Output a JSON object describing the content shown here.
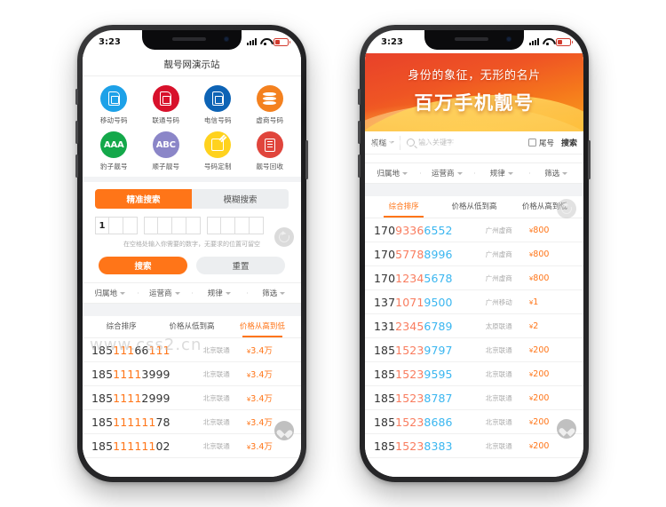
{
  "status_bar": {
    "time": "3:23",
    "signal_icon": "signal-bars-icon",
    "wifi_icon": "wifi-icon",
    "battery_icon": "battery-low-icon"
  },
  "watermark": {
    "text": "www.css2.cn"
  },
  "left_phone": {
    "app_title": "靓号网演示站",
    "categories": [
      {
        "label": "移动号码",
        "glyph": "sim-card-icon",
        "color": "#1da1e8"
      },
      {
        "label": "联通号码",
        "glyph": "sim-card-icon",
        "color": "#d8112b"
      },
      {
        "label": "电信号码",
        "glyph": "sim-card-icon",
        "color": "#0d63b5"
      },
      {
        "label": "虚商号码",
        "glyph": "coin-stack-icon",
        "color": "#f4811f"
      },
      {
        "label": "豹子靓号",
        "glyph": "aaa-text-icon",
        "color": "#14a84a",
        "text": "AAA"
      },
      {
        "label": "顺子靓号",
        "glyph": "abc-text-icon",
        "color": "#8b86c8",
        "text": "ABC"
      },
      {
        "label": "号码定制",
        "glyph": "pencil-edit-icon",
        "color": "#ffd21e"
      },
      {
        "label": "靓号回收",
        "glyph": "document-icon",
        "color": "#e0453c"
      }
    ],
    "search_tabs": [
      {
        "label": "精准搜索",
        "active": true
      },
      {
        "label": "模糊搜索",
        "active": false
      }
    ],
    "digit_groups": [
      [
        "1",
        "",
        ""
      ],
      [
        "",
        "",
        "",
        ""
      ],
      [
        "",
        "",
        "",
        ""
      ]
    ],
    "hint": "在空格处输入你需要的数字，无要求的位置可留空",
    "buttons": {
      "search": "搜索",
      "reset": "重置"
    },
    "filters": [
      "归属地",
      "运营商",
      "规律",
      "筛选"
    ],
    "sort_tabs": [
      {
        "label": "综合排序",
        "active": false
      },
      {
        "label": "价格从低到高",
        "active": false
      },
      {
        "label": "价格从高到低",
        "active": true
      }
    ],
    "numbers": [
      {
        "prefix": "185",
        "mid": "111",
        "suffix": "66",
        "tail": "111",
        "carrier": "北京联通",
        "currency": "¥",
        "price": "3.4万"
      },
      {
        "prefix": "185",
        "mid": "1111",
        "suffix": "3999",
        "tail": "",
        "carrier": "北京联通",
        "currency": "¥",
        "price": "3.4万"
      },
      {
        "prefix": "185",
        "mid": "1111",
        "suffix": "2999",
        "tail": "",
        "carrier": "北京联通",
        "currency": "¥",
        "price": "3.4万"
      },
      {
        "prefix": "185",
        "mid": "111111",
        "suffix": "78",
        "tail": "",
        "carrier": "北京联通",
        "currency": "¥",
        "price": "3.4万"
      },
      {
        "prefix": "185",
        "mid": "111111",
        "suffix": "02",
        "tail": "",
        "carrier": "北京联通",
        "currency": "¥",
        "price": "3.4万"
      }
    ],
    "fab": {
      "reset": "refresh-icon",
      "favorite": "heart-icon"
    }
  },
  "right_phone": {
    "banner": {
      "line1": "身份的象征，无形的名片",
      "line2": "百万手机靓号"
    },
    "search": {
      "mode_label": "模糊",
      "placeholder": "输入关键字",
      "checkbox_label": "尾号",
      "button_label": "搜索",
      "search_icon": "magnifier-icon"
    },
    "filters": [
      "归属地",
      "运营商",
      "规律",
      "筛选"
    ],
    "sort_tabs": [
      {
        "label": "综合排序",
        "active": true
      },
      {
        "label": "价格从低到高",
        "active": false
      },
      {
        "label": "价格从高到低",
        "active": false
      }
    ],
    "numbers": [
      {
        "prefix": "170",
        "orange": "9336",
        "blue": "6552",
        "carrier": "广州虚商",
        "currency": "¥",
        "price": "800"
      },
      {
        "prefix": "170",
        "orange": "5778",
        "blue": "8996",
        "carrier": "广州虚商",
        "currency": "¥",
        "price": "800"
      },
      {
        "prefix": "170",
        "orange": "1234",
        "blue": "5678",
        "carrier": "广州虚商",
        "currency": "¥",
        "price": "800"
      },
      {
        "prefix": "137",
        "orange": "1071",
        "blue": "9500",
        "carrier": "广州移动",
        "currency": "¥",
        "price": "1"
      },
      {
        "prefix": "131",
        "orange": "2345",
        "blue": "6789",
        "carrier": "太原联通",
        "currency": "¥",
        "price": "2"
      },
      {
        "prefix": "185",
        "orange": "1523",
        "blue": "9797",
        "carrier": "北京联通",
        "currency": "¥",
        "price": "200"
      },
      {
        "prefix": "185",
        "orange": "1523",
        "blue": "9595",
        "carrier": "北京联通",
        "currency": "¥",
        "price": "200"
      },
      {
        "prefix": "185",
        "orange": "1523",
        "blue": "8787",
        "carrier": "北京联通",
        "currency": "¥",
        "price": "200"
      },
      {
        "prefix": "185",
        "orange": "1523",
        "blue": "8686",
        "carrier": "北京联通",
        "currency": "¥",
        "price": "200"
      },
      {
        "prefix": "185",
        "orange": "1523",
        "blue": "8383",
        "carrier": "北京联通",
        "currency": "¥",
        "price": "200"
      }
    ],
    "fab": {
      "reset": "refresh-icon",
      "favorite": "heart-icon"
    }
  },
  "colors": {
    "accent_orange": "#ff7518",
    "accent_blue": "#3ab6f0",
    "banner_red": "#e8412a",
    "banner_yellow": "#f9a01b"
  }
}
